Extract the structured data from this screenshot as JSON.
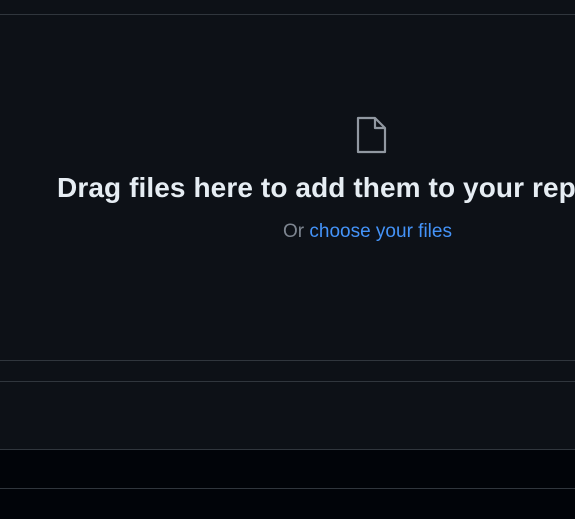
{
  "dropzone": {
    "icon": "file-icon",
    "title": "Drag files here to add them to your repository",
    "subtitle_prefix": "Or ",
    "choose_link": "choose your files"
  },
  "colors": {
    "background": "#0d1117",
    "border": "#30363d",
    "title": "#e6edf3",
    "muted": "#7d8590",
    "link": "#4493f8"
  }
}
